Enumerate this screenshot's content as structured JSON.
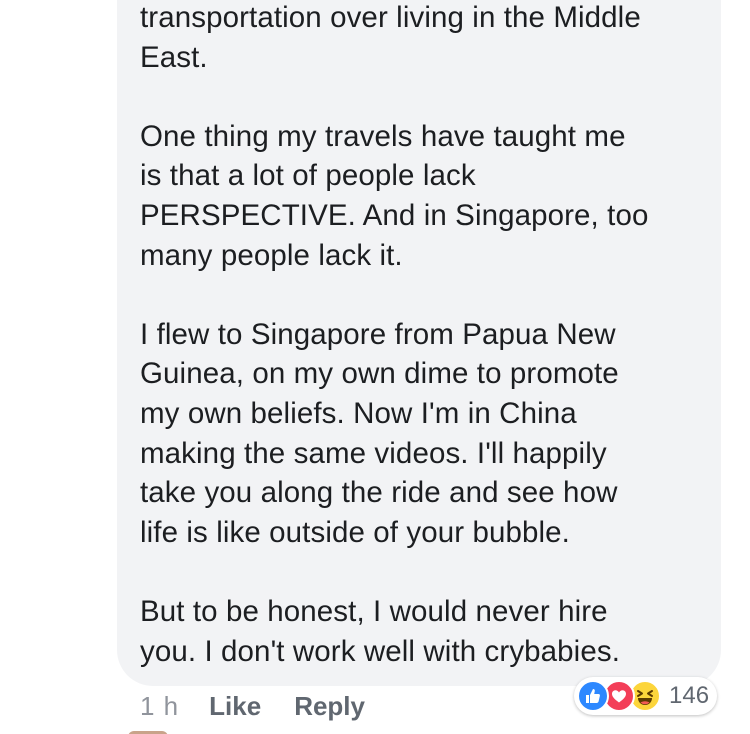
{
  "comment": {
    "paragraphs": [
      "transportation over living in the Middle\nEast.",
      "One thing my travels have taught me\nis that a lot of people lack\nPERSPECTIVE. And in Singapore, too\nmany people lack it.",
      "I flew to Singapore from Papua New\nGuinea, on my own dime to promote\nmy own beliefs. Now I'm in China\nmaking the same videos. I'll happily\ntake you along the ride and see how\nlife is like outside of your bubble.",
      "But to be honest, I would never hire\nyou. I don't work well with crybabies."
    ]
  },
  "actions": {
    "time": "1 h",
    "like_label": "Like",
    "reply_label": "Reply"
  },
  "reactions": {
    "icons": [
      "like-icon",
      "love-icon",
      "haha-icon"
    ],
    "count": "146"
  },
  "colors": {
    "bubble_bg": "#f2f3f5",
    "text": "#1c1e21",
    "meta": "#606770",
    "like_blue": "#2d88ff",
    "love_red": "#f33e58",
    "haha_yellow": "#fcd53b"
  }
}
